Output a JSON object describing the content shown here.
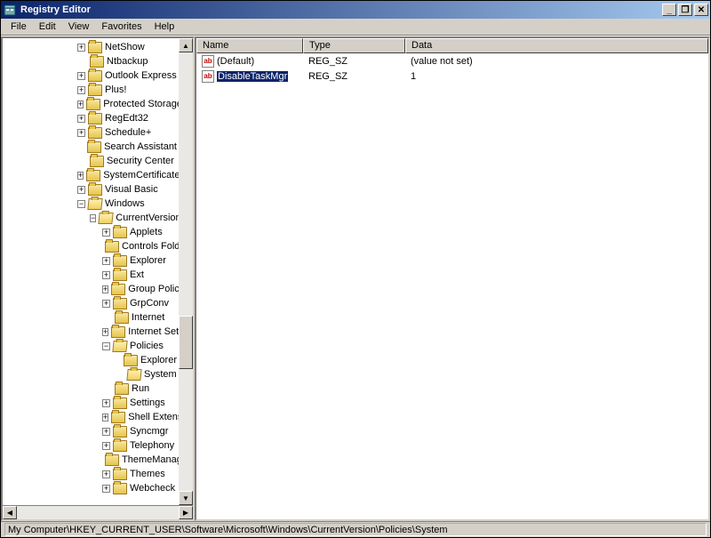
{
  "window": {
    "title": "Registry Editor"
  },
  "menu": {
    "file": "File",
    "edit": "Edit",
    "view": "View",
    "favorites": "Favorites",
    "help": "Help"
  },
  "tree": {
    "items": [
      {
        "indent": 6,
        "exp": "+",
        "open": false,
        "label": "NetShow"
      },
      {
        "indent": 6,
        "exp": "",
        "open": false,
        "label": "Ntbackup"
      },
      {
        "indent": 6,
        "exp": "+",
        "open": false,
        "label": "Outlook Express"
      },
      {
        "indent": 6,
        "exp": "+",
        "open": false,
        "label": "Plus!"
      },
      {
        "indent": 6,
        "exp": "+",
        "open": false,
        "label": "Protected Storage System Provider"
      },
      {
        "indent": 6,
        "exp": "+",
        "open": false,
        "label": "RegEdt32"
      },
      {
        "indent": 6,
        "exp": "+",
        "open": false,
        "label": "Schedule+"
      },
      {
        "indent": 6,
        "exp": "",
        "open": false,
        "label": "Search Assistant"
      },
      {
        "indent": 6,
        "exp": "",
        "open": false,
        "label": "Security Center"
      },
      {
        "indent": 6,
        "exp": "+",
        "open": false,
        "label": "SystemCertificates"
      },
      {
        "indent": 6,
        "exp": "+",
        "open": false,
        "label": "Visual Basic"
      },
      {
        "indent": 6,
        "exp": "-",
        "open": true,
        "label": "Windows"
      },
      {
        "indent": 7,
        "exp": "-",
        "open": true,
        "label": "CurrentVersion"
      },
      {
        "indent": 8,
        "exp": "+",
        "open": false,
        "label": "Applets"
      },
      {
        "indent": 8,
        "exp": "",
        "open": false,
        "label": "Controls Folder"
      },
      {
        "indent": 8,
        "exp": "+",
        "open": false,
        "label": "Explorer"
      },
      {
        "indent": 8,
        "exp": "+",
        "open": false,
        "label": "Ext"
      },
      {
        "indent": 8,
        "exp": "+",
        "open": false,
        "label": "Group Policy"
      },
      {
        "indent": 8,
        "exp": "+",
        "open": false,
        "label": "GrpConv"
      },
      {
        "indent": 8,
        "exp": "",
        "open": false,
        "label": "Internet"
      },
      {
        "indent": 8,
        "exp": "+",
        "open": false,
        "label": "Internet Settings"
      },
      {
        "indent": 8,
        "exp": "-",
        "open": true,
        "label": "Policies"
      },
      {
        "indent": 9,
        "exp": "",
        "open": false,
        "label": "Explorer"
      },
      {
        "indent": 9,
        "exp": "",
        "open": true,
        "label": "System"
      },
      {
        "indent": 8,
        "exp": "",
        "open": false,
        "label": "Run"
      },
      {
        "indent": 8,
        "exp": "+",
        "open": false,
        "label": "Settings"
      },
      {
        "indent": 8,
        "exp": "+",
        "open": false,
        "label": "Shell Extensions"
      },
      {
        "indent": 8,
        "exp": "+",
        "open": false,
        "label": "Syncmgr"
      },
      {
        "indent": 8,
        "exp": "+",
        "open": false,
        "label": "Telephony"
      },
      {
        "indent": 8,
        "exp": "",
        "open": false,
        "label": "ThemeManager"
      },
      {
        "indent": 8,
        "exp": "+",
        "open": false,
        "label": "Themes"
      },
      {
        "indent": 8,
        "exp": "+",
        "open": false,
        "label": "Webcheck"
      }
    ]
  },
  "list": {
    "cols": {
      "name": "Name",
      "type": "Type",
      "data": "Data"
    },
    "rows": [
      {
        "name": "(Default)",
        "type": "REG_SZ",
        "data": "(value not set)",
        "selected": false
      },
      {
        "name": "DisableTaskMgr",
        "type": "REG_SZ",
        "data": "1",
        "selected": true
      }
    ]
  },
  "status": {
    "path": "My Computer\\HKEY_CURRENT_USER\\Software\\Microsoft\\Windows\\CurrentVersion\\Policies\\System"
  }
}
